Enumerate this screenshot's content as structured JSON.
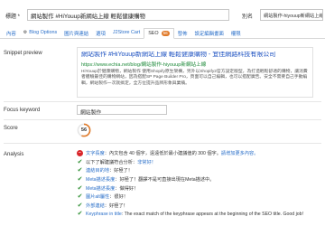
{
  "header": {
    "title_label": "標題 *",
    "title_value": "網站製作 #HiYouup新網站上線 輕鬆健康購物",
    "alias_label": "別名",
    "alias_value": "網站製作-hiyouup新網站上線"
  },
  "tabs": [
    {
      "label": "內容",
      "icon": "",
      "active": false
    },
    {
      "label": "Blog Options",
      "icon": "gear-icon",
      "active": false
    },
    {
      "label": "圖片與連結",
      "icon": "",
      "active": false
    },
    {
      "label": "選項",
      "icon": "",
      "active": false
    },
    {
      "label": "J2Store Cart",
      "icon": "",
      "active": false
    },
    {
      "label": "SEO",
      "badge": "56",
      "active": true
    },
    {
      "label": "發佈",
      "icon": "",
      "active": false
    },
    {
      "label": "設定編輯畫面",
      "icon": "",
      "active": false
    },
    {
      "label": "權限",
      "icon": "",
      "active": false
    }
  ],
  "snippet": {
    "label": "Snippet preview",
    "title": "網站製作 #HiYouup新網站上線 輕鬆健康購物 - 宜佳網路科技有限公司",
    "url": "https://www.echia.net/blog/網站製作-hiyouup新網站上線",
    "desc": "HiYouup於健康購物，網站製作 使用Shopify原生架構，另外以Shopify2官方設定版型，為打造輕鬆舒適的購物，讓消費者體驗最佳的購物網站，因為搭配SP Page Builder Pro，頁面可以自己編輯，也可以搭配廣告。安全不需要自己手動編輯，網站製作一次就搞定，全方位提升品牌形象與業績。"
  },
  "focus_keyword": {
    "label": "Focus keyword",
    "value": "網站製作"
  },
  "score": {
    "label": "Score",
    "value": "56",
    "fraction": 0.56,
    "color": "#e07a2a"
  },
  "analysis": {
    "label": "Analysis",
    "items": [
      {
        "status": "bad",
        "key": "文字長度",
        "text": "：內文包含 40 個字，遠遠低於最小建議值的 300 個字。",
        "link": "請增加更多內容。"
      },
      {
        "status": "ok",
        "key": "",
        "text": "以下了解建議符合分析：",
        "link": "非常好！"
      },
      {
        "status": "ok",
        "key": "連結目的地",
        "text": "：好極了！",
        "link": ""
      },
      {
        "status": "ok",
        "key": "Meta描述長度",
        "text": "：好極了！翻譯不是可直接出現在Meta描述中。",
        "link": ""
      },
      {
        "status": "ok",
        "key": "Meta描述長度",
        "text": "：做得好！",
        "link": ""
      },
      {
        "status": "ok",
        "key": "圖片alt屬性",
        "text": "：很好！",
        "link": ""
      },
      {
        "status": "ok",
        "key": "外部連結",
        "text": "：好極了！",
        "link": ""
      },
      {
        "status": "ok",
        "key": "Keyphrase in title",
        "text": ": The exact match of the keyphrase appears at the beginning of the SEO title. Good job!",
        "link": ""
      }
    ]
  },
  "colors": {
    "link": "#2a6fc9",
    "url_green": "#1e8a3a",
    "bad": "#d9262b",
    "good": "#2f8f34",
    "badge": "#e07a2a"
  }
}
